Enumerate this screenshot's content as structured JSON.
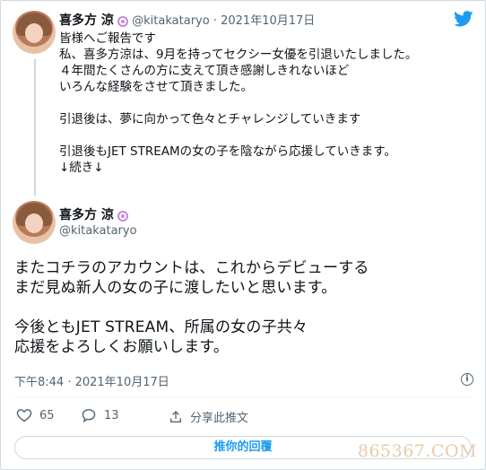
{
  "tweet1": {
    "name": "喜多方 涼",
    "handle": "@kitakataryo",
    "separator": "·",
    "date": "2021年10月17日",
    "text": "皆様へご報告です\n私、喜多方涼は、9月を持ってセクシー女優を引退いたしました。\n４年間たくさんの方に支えて頂き感謝しきれないほど\nいろんな経験をさせて頂きました。\n\n引退後は、夢に向かって色々とチャレンジしていきます\n\n引退後もJET STREAMの女の子を陰ながら応援していきます。\n↓続き↓"
  },
  "tweet2": {
    "name": "喜多方 涼",
    "handle": "@kitakataryo",
    "text": "またコチラのアカウントは、これからデビューする\nまだ見ぬ新人の女の子に渡したいと思います。\n\n今後ともJET STREAM、所属の女の子共々\n応援をよろしくお願いします。",
    "timestamp": "下午8:44 · 2021年10月17日"
  },
  "actions": {
    "likes": "65",
    "replies": "13",
    "share_label": "分享此推文"
  },
  "reply_button_label": "推你的回覆",
  "watermark": "865367.COM",
  "colors": {
    "accent": "#1d9bf0",
    "muted": "#536471",
    "like": "#536471"
  },
  "icons": [
    "twitter-bird-icon",
    "heart-icon",
    "reply-icon",
    "share-icon",
    "info-icon",
    "profile-badge-icon"
  ]
}
